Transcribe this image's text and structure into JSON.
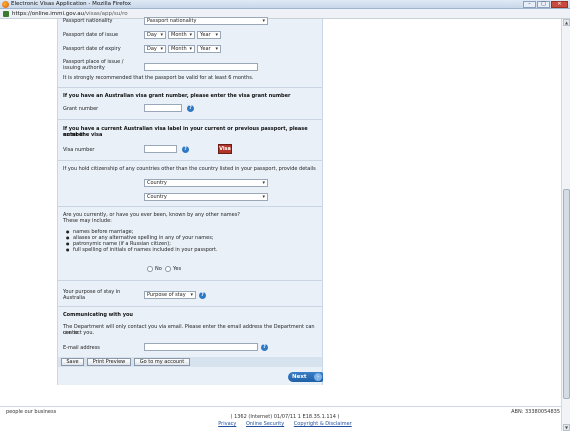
{
  "browser": {
    "title": "Electronic Visas Application - Mozilla Firefox",
    "url_host": "https://online.immi.gov.au",
    "url_path": "/visas/app/su/ro",
    "window_buttons": [
      "–",
      "□",
      "✕"
    ]
  },
  "form": {
    "passport_nationality_label": "Passport nationality",
    "passport_nationality_value": "Passport nationality",
    "date_issue_label": "Passport date of issue",
    "date_expiry_label": "Passport date of expiry",
    "day": "Day",
    "month": "Month",
    "year": "Year",
    "place_issue_label_1": "Passport place of issue /",
    "place_issue_label_2": "issuing authority",
    "passport_note": "It is strongly recommended that the passport be valid for at least 6 months.",
    "grant_heading": "If you have an Australian visa grant number, please enter the visa grant number",
    "grant_label": "Grant number",
    "visa_label_heading_1": "If you have a current Australian visa label in your current or previous passport, please enter the visa",
    "visa_label_heading_2": "number",
    "visa_number_label": "Visa number",
    "visa_image_text": "Visa",
    "citizenship_text": "If you hold citizenship of any countries other than the country listed in your passport, provide details",
    "country_1": "Country",
    "country_2": "Country",
    "other_names_q1": "Are you currently, or have you ever been, known by any other names?",
    "other_names_q2": "These may include:",
    "bullets": [
      "names before marriage;",
      "aliases or any alternative spelling in any of your names;",
      "patronymic name (if a Russian citizen);",
      "full spelling of initials of names included in your passport."
    ],
    "no_label": "No",
    "yes_label": "Yes",
    "purpose_label_1": "Your purpose of stay in",
    "purpose_label_2": "Australia",
    "purpose_value": "Purpose of stay",
    "communicating_heading": "Communicating with you",
    "communicating_text_1": "The Department will only contact you via email. Please enter the email address the Department can use to",
    "communicating_text_2": "contact you.",
    "email_label": "E-mail address",
    "help_glyph": "?"
  },
  "buttons": {
    "save": "Save",
    "print_preview": "Print Preview",
    "account": "Go to my account",
    "next": "Next",
    "next_arrow": "›"
  },
  "footer": {
    "people": "people our business",
    "abn": "ABN: 33380054835",
    "version": "( 1362 (Internet) 01/07/11 1 E18.35.1.114 )",
    "links": [
      "Privacy",
      "Online Security",
      "Copyright & Disclaimer"
    ]
  },
  "colors": {
    "form_bg": "#e9f0f8",
    "help": "#2f78c4",
    "next": "#1f5fa6"
  }
}
